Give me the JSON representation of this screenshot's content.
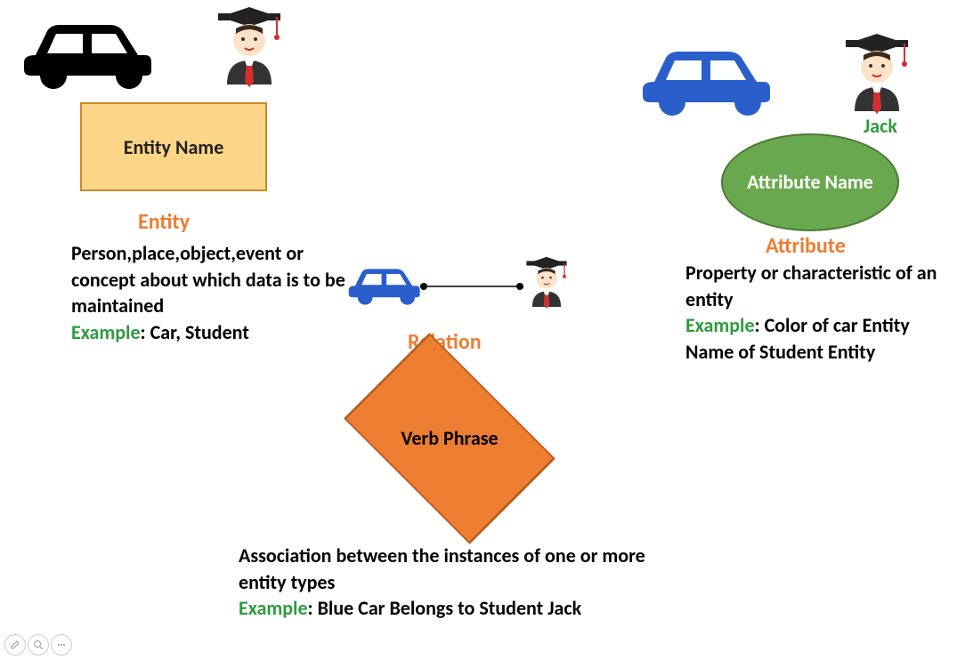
{
  "entity": {
    "box_label": "Entity Name",
    "title": "Entity",
    "desc": "Person,place,object,event or concept about which data is to be maintained",
    "example_label": "Example",
    "example_text": ": Car, Student"
  },
  "attribute": {
    "jack_label": "Jack",
    "ellipse_label": "Attribute Name",
    "title": "Attribute",
    "desc": "Property or characteristic of an entity",
    "example_label": "Example",
    "example_text": ": Color of car Entity Name of Student Entity"
  },
  "relation": {
    "diamond_label": "Verb Phrase",
    "title": "Relation",
    "desc": "Association between the instances of one or more entity types",
    "example_label": "Example",
    "example_text": ": Blue Car Belongs to Student Jack"
  }
}
